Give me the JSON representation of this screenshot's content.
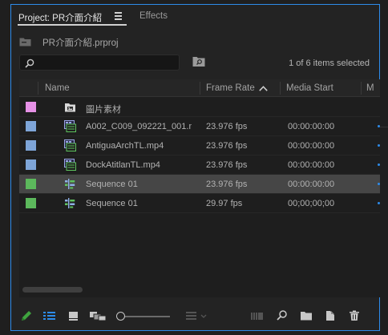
{
  "tabs": {
    "project_label": "Project: PR介面介紹",
    "effects_label": "Effects"
  },
  "project": {
    "file_name": "PR介面介紹.prproj"
  },
  "search": {
    "value": "",
    "placeholder": ""
  },
  "status": {
    "items_selected": "1 of 6 items selected"
  },
  "columns": {
    "name": "Name",
    "frame_rate": "Frame Rate",
    "media_start": "Media Start",
    "next": "M"
  },
  "sort": {
    "column": "frame_rate",
    "direction": "ascending"
  },
  "rows": [
    {
      "label_color": "#e691e6",
      "icon": "bin-icon",
      "name": "圖片素材",
      "frame_rate": "",
      "media_start": "",
      "selected": false
    },
    {
      "label_color": "#7ea5d8",
      "icon": "video-clip-icon",
      "name": "A002_C009_092221_001.m",
      "frame_rate": "23.976 fps",
      "media_start": "00:00:00:00",
      "selected": false
    },
    {
      "label_color": "#7ea5d8",
      "icon": "video-clip-icon",
      "name": "AntiguaArchTL.mp4",
      "frame_rate": "23.976 fps",
      "media_start": "00:00:00:00",
      "selected": false
    },
    {
      "label_color": "#7ea5d8",
      "icon": "video-clip-icon",
      "name": "DockAtitlanTL.mp4",
      "frame_rate": "23.976 fps",
      "media_start": "00:00:00:00",
      "selected": false
    },
    {
      "label_color": "#5cb85c",
      "icon": "sequence-icon",
      "name": "Sequence 01",
      "frame_rate": "23.976 fps",
      "media_start": "00:00:00:00",
      "selected": true
    },
    {
      "label_color": "#5cb85c",
      "icon": "sequence-icon",
      "name": "Sequence 01",
      "frame_rate": "29.97 fps",
      "media_start": "00;00;00;00",
      "selected": false
    }
  ],
  "colors": {
    "accent": "#2d8ceb",
    "panel_bg": "#232323",
    "list_bg": "#1e1e1e",
    "selected_row": "#464646"
  },
  "toolbar_icons": [
    "pencil-icon",
    "list-view-icon",
    "icon-view-icon",
    "freeform-view-icon",
    "zoom-slider",
    "sort-icons-icon",
    "automate-to-sequence-icon",
    "find-icon",
    "new-bin-icon",
    "new-item-icon",
    "trash-icon"
  ]
}
